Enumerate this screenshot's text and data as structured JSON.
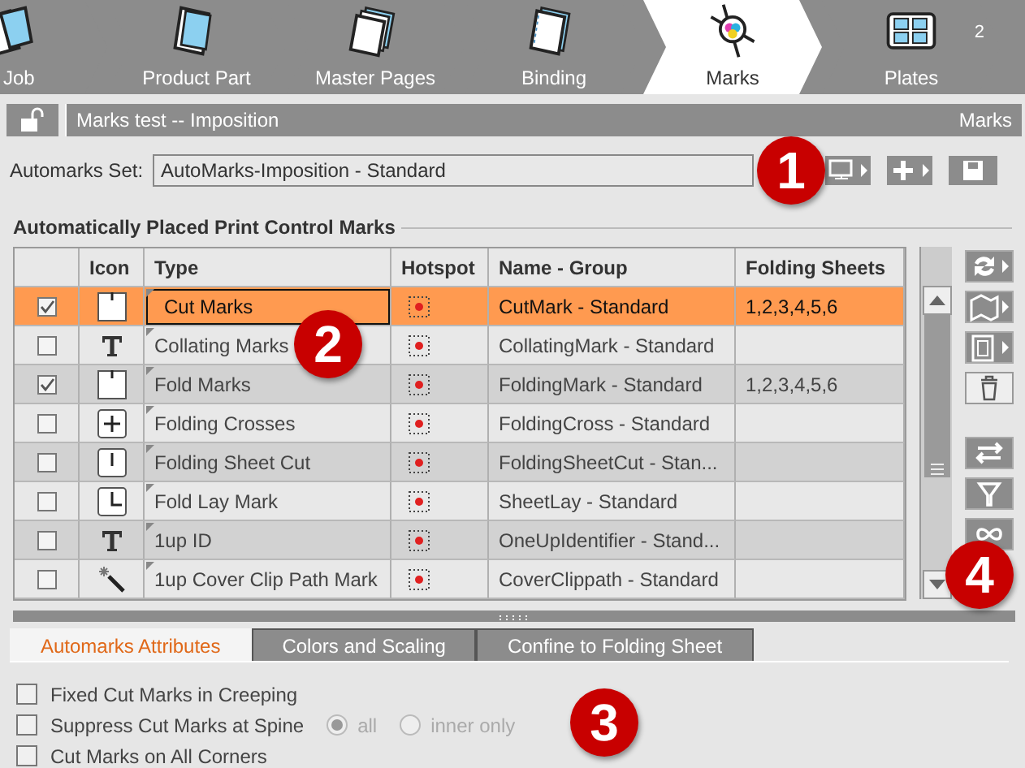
{
  "workflow_tabs": [
    {
      "label": "Job",
      "kind": "job",
      "selected": false
    },
    {
      "label": "Product Part",
      "kind": "product",
      "selected": false
    },
    {
      "label": "Master Pages",
      "kind": "pages",
      "selected": false
    },
    {
      "label": "Binding",
      "kind": "binding",
      "selected": false
    },
    {
      "label": "Marks",
      "kind": "marks",
      "selected": true
    },
    {
      "label": "Plates",
      "kind": "plates",
      "selected": false,
      "badge": "2"
    }
  ],
  "title_bar": {
    "locked": false,
    "title": "Marks test -- Imposition",
    "section": "Marks"
  },
  "automarks_set": {
    "label": "Automarks Set:",
    "value": "AutoMarks-Imposition - Standard"
  },
  "table": {
    "heading": "Automatically Placed Print Control Marks",
    "columns": [
      "",
      "Icon",
      "Type",
      "Hotspot",
      "Name - Group",
      "Folding Sheets"
    ],
    "rows": [
      {
        "checked": true,
        "selected": true,
        "kind": "cut",
        "type": "Cut Marks",
        "name": "CutMark - Standard",
        "sheets": "1,2,3,4,5,6"
      },
      {
        "checked": false,
        "selected": false,
        "kind": "text",
        "type": "Collating Marks",
        "name": "CollatingMark - Standard",
        "sheets": ""
      },
      {
        "checked": true,
        "selected": false,
        "kind": "fold",
        "type": "Fold Marks",
        "name": "FoldingMark - Standard",
        "sheets": "1,2,3,4,5,6"
      },
      {
        "checked": false,
        "selected": false,
        "kind": "cross",
        "type": "Folding Crosses",
        "name": "FoldingCross - Standard",
        "sheets": ""
      },
      {
        "checked": false,
        "selected": false,
        "kind": "sheetcut",
        "type": "Folding Sheet Cut",
        "name": "FoldingSheetCut - Stan...",
        "sheets": ""
      },
      {
        "checked": false,
        "selected": false,
        "kind": "lay",
        "type": "Fold Lay Mark",
        "name": "SheetLay - Standard",
        "sheets": ""
      },
      {
        "checked": false,
        "selected": false,
        "kind": "text",
        "type": "1up ID",
        "name": "OneUpIdentifier - Stand...",
        "sheets": ""
      },
      {
        "checked": false,
        "selected": false,
        "kind": "wand",
        "type": "1up Cover Clip Path Mark",
        "name": "CoverClippath - Standard",
        "sheets": ""
      }
    ]
  },
  "panel_tabs": [
    {
      "label": "Automarks Attributes",
      "selected": true
    },
    {
      "label": "Colors and Scaling",
      "selected": false
    },
    {
      "label": "Confine to Folding Sheet",
      "selected": false
    }
  ],
  "options": [
    {
      "label": "Fixed Cut Marks in Creeping",
      "checked": false
    },
    {
      "label": "Suppress Cut Marks at Spine",
      "checked": false,
      "radios": [
        {
          "label": "all",
          "selected": true,
          "disabled": true
        },
        {
          "label": "inner only",
          "selected": false,
          "disabled": true
        }
      ]
    },
    {
      "label": "Cut Marks on All Corners",
      "checked": false
    }
  ],
  "callouts": [
    "1",
    "2",
    "3",
    "4"
  ]
}
